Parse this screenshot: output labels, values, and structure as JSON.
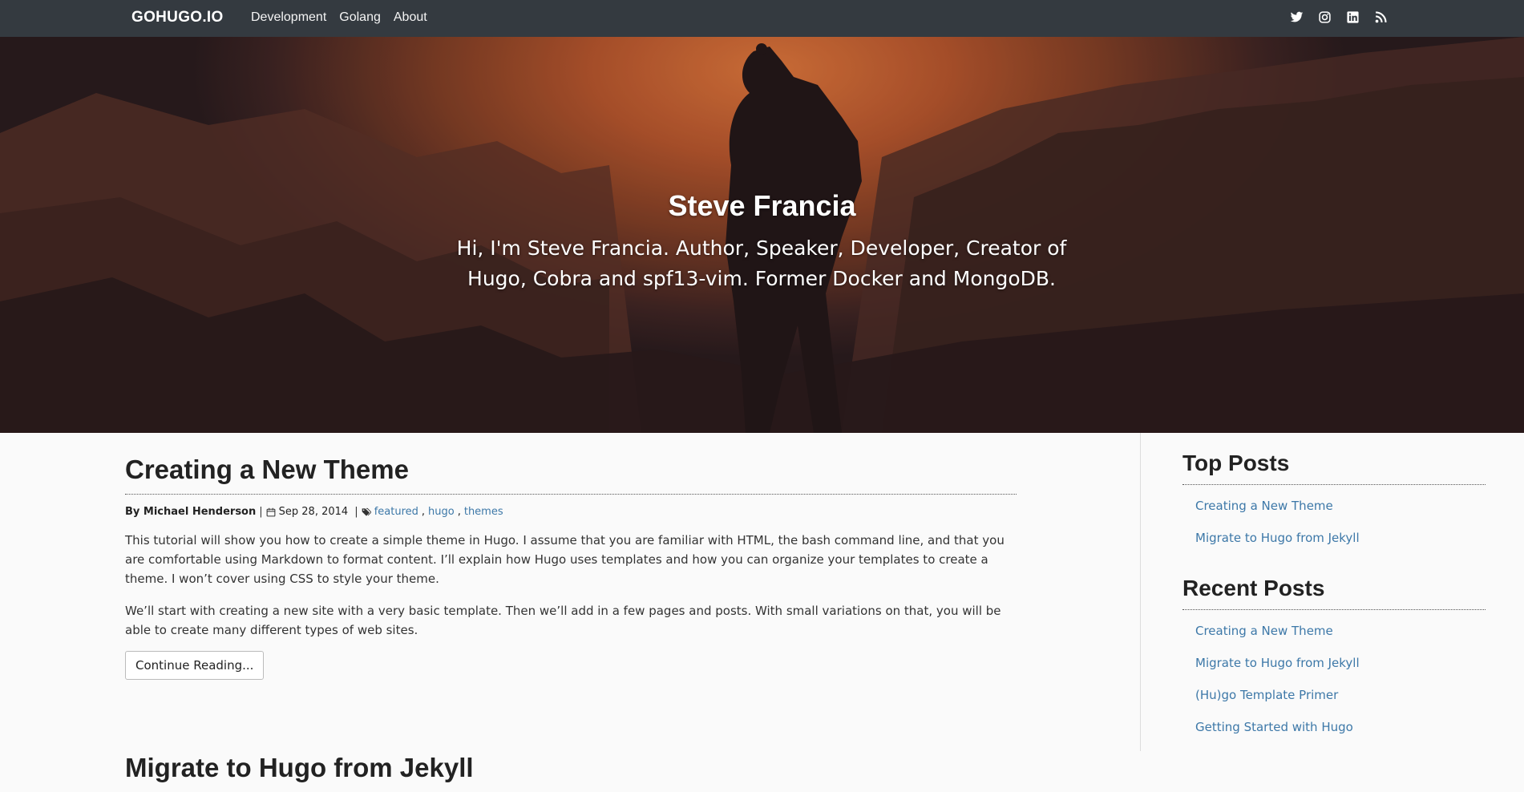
{
  "navbar": {
    "brand": "GOHUGO.IO",
    "links": [
      "Development",
      "Golang",
      "About"
    ],
    "social_icons": [
      "twitter-icon",
      "instagram-icon",
      "linkedin-icon",
      "rss-icon"
    ]
  },
  "hero": {
    "title": "Steve Francia",
    "subtitle": "Hi, I'm Steve Francia. Author, Speaker, Developer, Creator of Hugo, Cobra and spf13-vim. Former Docker and MongoDB."
  },
  "posts": [
    {
      "title": "Creating a New Theme",
      "author": "By Michael Henderson",
      "date": "Sep 28, 2014",
      "tags": [
        "featured",
        "hugo",
        "themes"
      ],
      "paragraphs": [
        "This tutorial will show you how to create a simple theme in Hugo. I assume that you are familiar with HTML, the bash command line, and that you are comfortable using Markdown to format content. I’ll explain how Hugo uses templates and how you can organize your templates to create a theme. I won’t cover using CSS to style your theme.",
        "We’ll start with creating a new site with a very basic template. Then we’ll add in a few pages and posts. With small variations on that, you will be able to create many different types of web sites."
      ],
      "button": "Continue Reading..."
    },
    {
      "title": "Migrate to Hugo from Jekyll"
    }
  ],
  "sidebar": {
    "top_posts": {
      "title": "Top Posts",
      "items": [
        "Creating a New Theme",
        "Migrate to Hugo from Jekyll"
      ]
    },
    "recent_posts": {
      "title": "Recent Posts",
      "items": [
        "Creating a New Theme",
        "Migrate to Hugo from Jekyll",
        "(Hu)go Template Primer",
        "Getting Started with Hugo"
      ]
    }
  },
  "colors": {
    "navbar_bg": "#343a40",
    "link": "#3d78a8",
    "hero_sky": "#d9743b"
  }
}
